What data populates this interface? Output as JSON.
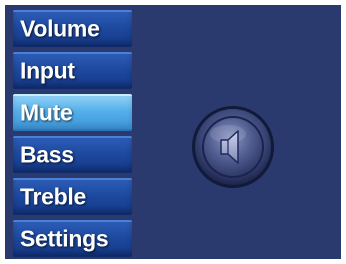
{
  "menu": {
    "items": [
      {
        "label": "Volume",
        "icon": "",
        "active": false
      },
      {
        "label": "Input",
        "icon": "",
        "active": false
      },
      {
        "label": "Mute",
        "icon": "",
        "active": true
      },
      {
        "label": "Bass",
        "icon": "",
        "active": false
      },
      {
        "label": "Treble",
        "icon": "",
        "active": false
      },
      {
        "label": "Settings",
        "icon": "",
        "active": false
      }
    ]
  },
  "main": {
    "indicator_icon": "speaker-muted-icon"
  },
  "colors": {
    "background": "#2a3a6e",
    "menu_item": "#1e4aa0",
    "menu_item_active": "#55b0ea",
    "label_text": "#ffffff"
  }
}
